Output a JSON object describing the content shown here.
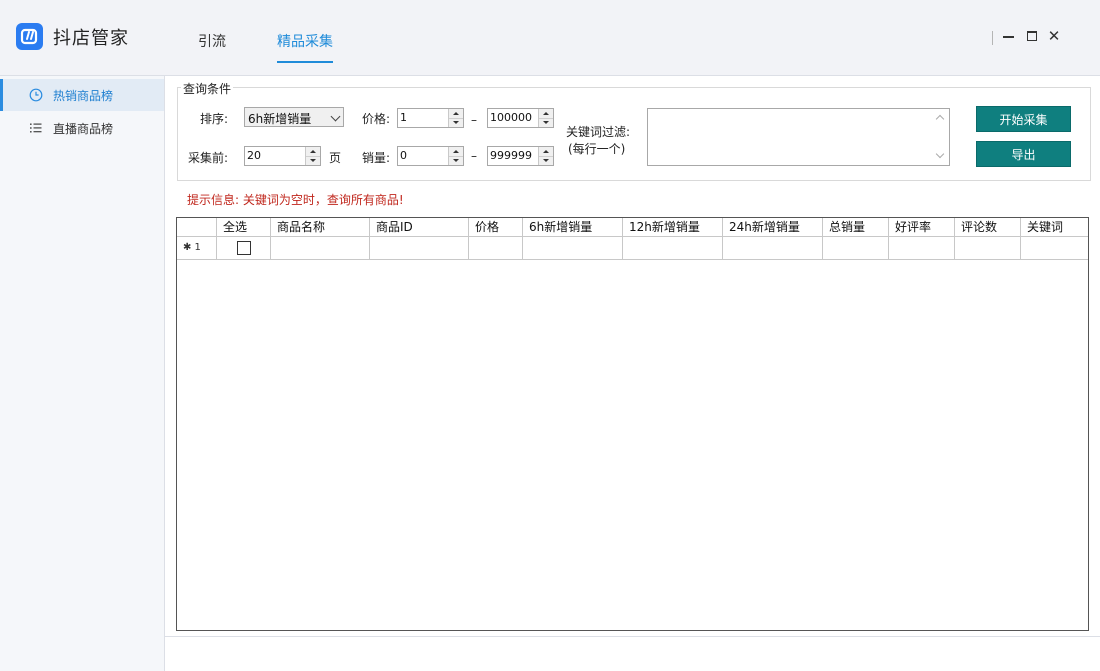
{
  "app": {
    "title": "抖店管家",
    "logo_icon": "logo-icon"
  },
  "nav": {
    "tabs": [
      "引流",
      "精品采集"
    ],
    "active": "精品采集"
  },
  "window": {
    "minimize": "minimize-icon",
    "maximize": "maximize-icon",
    "close": "✕"
  },
  "sidebar": {
    "items": [
      {
        "label": "热销商品榜",
        "icon": "clock-icon",
        "active": true
      },
      {
        "label": "直播商品榜",
        "icon": "list-icon",
        "active": false
      }
    ]
  },
  "query": {
    "legend": "查询条件",
    "sort_label": "排序:",
    "sort_value": "6h新增销量",
    "price_label": "价格:",
    "price_min": "1",
    "price_max": "100000",
    "collect_label": "采集前:",
    "collect_pages": "20",
    "page_unit": "页",
    "sales_label": "销量:",
    "sales_min": "0",
    "sales_max": "999999",
    "dash": "–",
    "keyword_label": "关键词过滤:",
    "keyword_sub": "(每行一个)",
    "keyword_value": "",
    "start_button": "开始采集",
    "export_button": "导出"
  },
  "hint": "提示信息: 关键词为空时，查询所有商品!",
  "grid": {
    "columns": [
      "全选",
      "商品名称",
      "商品ID",
      "价格",
      "6h新增销量",
      "12h新增销量",
      "24h新增销量",
      "总销量",
      "好评率",
      "评论数",
      "关键词"
    ],
    "rows": [
      {
        "row_header": "✱ 1",
        "checked": false
      }
    ]
  },
  "colors": {
    "accent": "#1f8bd9",
    "button": "#0f7f7f",
    "hint": "#c0271d"
  }
}
